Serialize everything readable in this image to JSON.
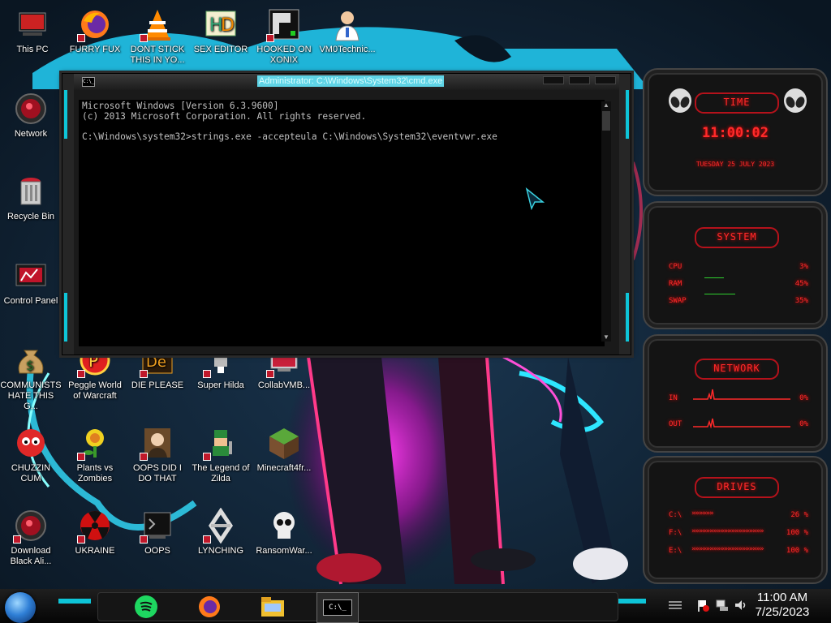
{
  "desktop": {
    "icons": [
      {
        "label": "This PC",
        "icon": "this-pc-icon"
      },
      {
        "label": "FURRY FUX",
        "icon": "firefox-icon"
      },
      {
        "label": "DONT STICK THIS IN YO...",
        "icon": "vlc-cone-icon"
      },
      {
        "label": "SEX EDITOR",
        "icon": "hex-editor-icon"
      },
      {
        "label": "HOOKED ON XONIX",
        "icon": "xonix-icon"
      },
      {
        "label": "VM0Technic...",
        "icon": "doctor-icon"
      },
      {
        "label": "Network",
        "icon": "network-icon"
      },
      {
        "label": "Recycle Bin",
        "icon": "recycle-bin-icon"
      },
      {
        "label": "Control Panel",
        "icon": "control-panel-icon"
      },
      {
        "label": "COMMUNISTS HATE THIS G...",
        "icon": "money-bag-icon"
      },
      {
        "label": "Peggle World of Warcraft",
        "icon": "peggle-icon"
      },
      {
        "label": "DIE PLEASE",
        "icon": "adobe-de-icon"
      },
      {
        "label": "Super Hilda",
        "icon": "pixel-sprite-icon"
      },
      {
        "label": "CollabVMB...",
        "icon": "collabvm-icon"
      },
      {
        "label": "CHUZZIN CUM",
        "icon": "chuzzle-icon"
      },
      {
        "label": "Plants vs Zombies",
        "icon": "pvz-flower-icon"
      },
      {
        "label": "OOPS DID I DO THAT",
        "icon": "portrait-icon"
      },
      {
        "label": "The Legend of Zilda",
        "icon": "zelda-icon"
      },
      {
        "label": "Minecraft4fr...",
        "icon": "minecraft-block-icon"
      },
      {
        "label": "Download Black Ali...",
        "icon": "alien-orb-icon"
      },
      {
        "label": "UKRAINE",
        "icon": "radiation-icon"
      },
      {
        "label": "OOPS",
        "icon": "terminal-icon"
      },
      {
        "label": "LYNCHING",
        "icon": "knot-icon"
      },
      {
        "label": "RansomWar...",
        "icon": "skull-icon"
      }
    ]
  },
  "cmd_window": {
    "title": "Administrator: C:\\Windows\\System32\\cmd.exe",
    "icon_text": "C:\\_",
    "lines": [
      "Microsoft Windows [Version 6.3.9600]",
      "(c) 2013 Microsoft Corporation. All rights reserved.",
      "",
      "C:\\Windows\\system32>strings.exe -accepteula C:\\Windows\\System32\\eventvwr.exe"
    ]
  },
  "gadgets": {
    "time": {
      "header": "TIME",
      "clock": "11:00:02",
      "date": "TUESDAY 25 JULY 2023"
    },
    "system": {
      "header": "SYSTEM",
      "cpu_label": "CPU",
      "cpu_value": "3%",
      "ram_label": "RAM",
      "ram_value": "45%",
      "swap_label": "SWAP",
      "swap_value": "35%"
    },
    "network": {
      "header": "NETWORK",
      "in_label": "IN",
      "in_value": "0%",
      "out_label": "OUT",
      "out_value": "0%"
    },
    "drives": {
      "header": "DRIVES",
      "items": [
        {
          "label": "C:\\",
          "value": "26 %"
        },
        {
          "label": "F:\\",
          "value": "100 %"
        },
        {
          "label": "E:\\",
          "value": "100 %"
        }
      ]
    }
  },
  "taskbar": {
    "clock_time": "11:00 AM",
    "clock_date": "7/25/2023",
    "cmd_label": "C:\\_",
    "accent": "#0ec5d8"
  }
}
